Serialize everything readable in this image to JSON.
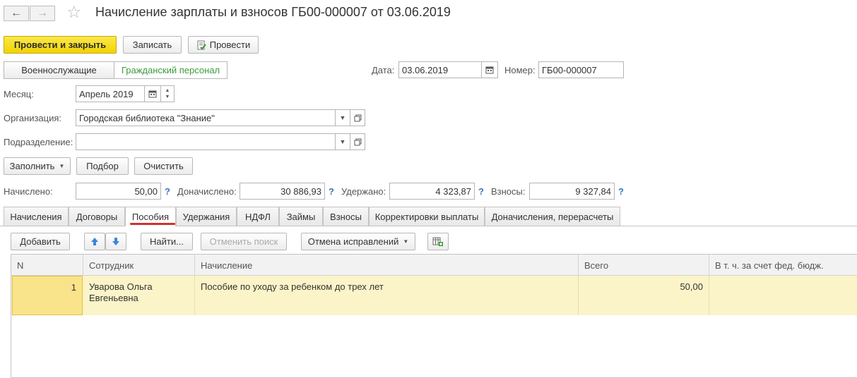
{
  "window": {
    "title": "Начисление зарплаты и взносов ГБ00-000007 от 03.06.2019"
  },
  "toolbar": {
    "post_close": "Провести и закрыть",
    "write": "Записать",
    "post": "Провести"
  },
  "segments": {
    "military": "Военнослужащие",
    "civil": "Гражданский персонал"
  },
  "date": {
    "label": "Дата:",
    "value": "03.06.2019"
  },
  "number": {
    "label": "Номер:",
    "value": "ГБ00-000007"
  },
  "month": {
    "label": "Месяц:",
    "value": "Апрель 2019"
  },
  "organization": {
    "label": "Организация:",
    "value": "Городская библиотека \"Знание\""
  },
  "department": {
    "label": "Подразделение:",
    "value": ""
  },
  "actions": {
    "fill": "Заполнить",
    "pick": "Подбор",
    "clear": "Очистить"
  },
  "totals": {
    "accrued_label": "Начислено:",
    "accrued": "50,00",
    "extra_label": "Доначислено:",
    "extra": "30 886,93",
    "withheld_label": "Удержано:",
    "withheld": "4 323,87",
    "contrib_label": "Взносы:",
    "contrib": "9 327,84",
    "help": "?"
  },
  "tabs": [
    "Начисления",
    "Договоры",
    "Пособия",
    "Удержания",
    "НДФЛ",
    "Займы",
    "Взносы",
    "Корректировки выплаты",
    "Доначисления, перерасчеты"
  ],
  "active_tab": "Пособия",
  "table_toolbar": {
    "add": "Добавить",
    "find": "Найти...",
    "cancel_search": "Отменить поиск",
    "cancel_corrections": "Отмена исправлений"
  },
  "table": {
    "columns": [
      "N",
      "Сотрудник",
      "Начисление",
      "Всего",
      "В т. ч. за счет фед. бюдж."
    ],
    "rows": [
      {
        "n": "1",
        "employee": "Уварова Ольга Евгеньевна",
        "accrual": "Пособие по уходу за ребенком до трех лет",
        "total": "50,00",
        "fed": ""
      }
    ]
  },
  "colors": {
    "primary_button": "#f5d800",
    "active_segment_text": "#3c9a3c",
    "help_mark": "#3778bd",
    "row_highlight": "#fbf4c8",
    "tab_underline": "#d32f2f"
  }
}
